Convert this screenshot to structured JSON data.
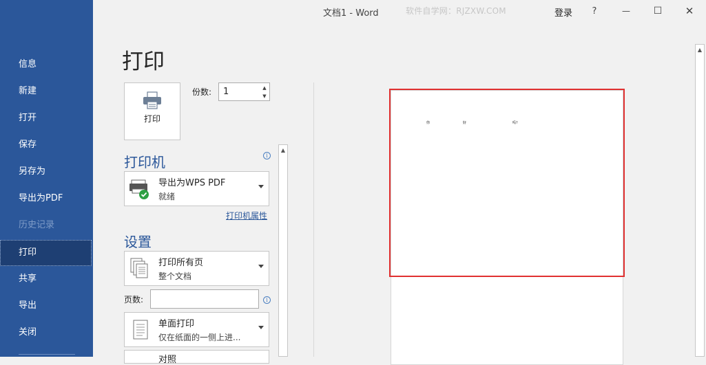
{
  "titlebar": {
    "title": "文档1 -  Word",
    "watermark": "软件自学网：RJZXW.COM",
    "login": "登录",
    "help": "?",
    "minimize": "—",
    "maximize": "☐",
    "close": "✕"
  },
  "sidebar": {
    "items": [
      {
        "label": "信息"
      },
      {
        "label": "新建"
      },
      {
        "label": "打开"
      },
      {
        "label": "保存"
      },
      {
        "label": "另存为"
      },
      {
        "label": "导出为PDF"
      },
      {
        "label": "历史记录"
      },
      {
        "label": "打印"
      },
      {
        "label": "共享"
      },
      {
        "label": "导出"
      },
      {
        "label": "关闭"
      }
    ]
  },
  "print": {
    "page_title": "打印",
    "print_button_label": "打印",
    "copies_label": "份数:",
    "copies_value": "1",
    "printer_section": "打印机",
    "printer_name": "导出为WPS PDF",
    "printer_status": "就绪",
    "printer_properties_link": "打印机属性",
    "settings_section": "设置",
    "pages_option": "打印所有页",
    "pages_option_sub": "整个文档",
    "pages_label": "页数:",
    "pages_value": "",
    "sides_option": "单面打印",
    "sides_option_sub": "仅在纸面的一侧上进...",
    "next_option_partial": "对照"
  },
  "preview": {
    "words": [
      "你",
      "好",
      "吗?"
    ]
  },
  "colors": {
    "sidebar_bg": "#2b579a",
    "sidebar_active": "#1e3f73",
    "accent_blue": "#2b579a",
    "highlight_red": "#e03030",
    "status_ok": "#2ea043"
  },
  "icons": {
    "print_button": "printer-icon",
    "printer_dropdown": "printer-status-ok-icon",
    "pages_dropdown": "pages-stack-icon",
    "sides_dropdown": "single-page-icon"
  }
}
